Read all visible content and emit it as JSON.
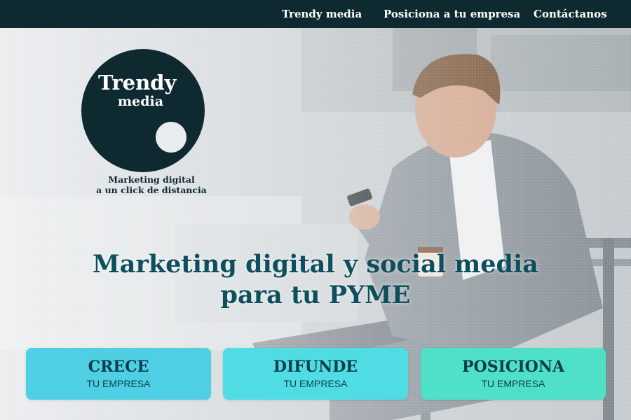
{
  "nav": {
    "items": [
      "Trendy media",
      "Posiciona a tu empresa",
      "Contáctanos"
    ]
  },
  "logo": {
    "word1": "Trendy",
    "word2": "media",
    "tagline_line1": "Marketing digital",
    "tagline_line2": "a un click de distancia"
  },
  "hero": {
    "headline_line1": "Marketing digital y social media",
    "headline_line2": "para tu PYME"
  },
  "cards": [
    {
      "title": "CRECE",
      "subtitle": "TU EMPRESA"
    },
    {
      "title": "DIFUNDE",
      "subtitle": "TU EMPRESA"
    },
    {
      "title": "POSICIONA",
      "subtitle": "TU EMPRESA"
    }
  ],
  "colors": {
    "nav_bg": "#0e2a30",
    "headline": "#0d4f5d",
    "card_crece": "#4ecfe3",
    "card_difunde": "#4fdde3",
    "card_posiciona": "#4fe0c8"
  }
}
